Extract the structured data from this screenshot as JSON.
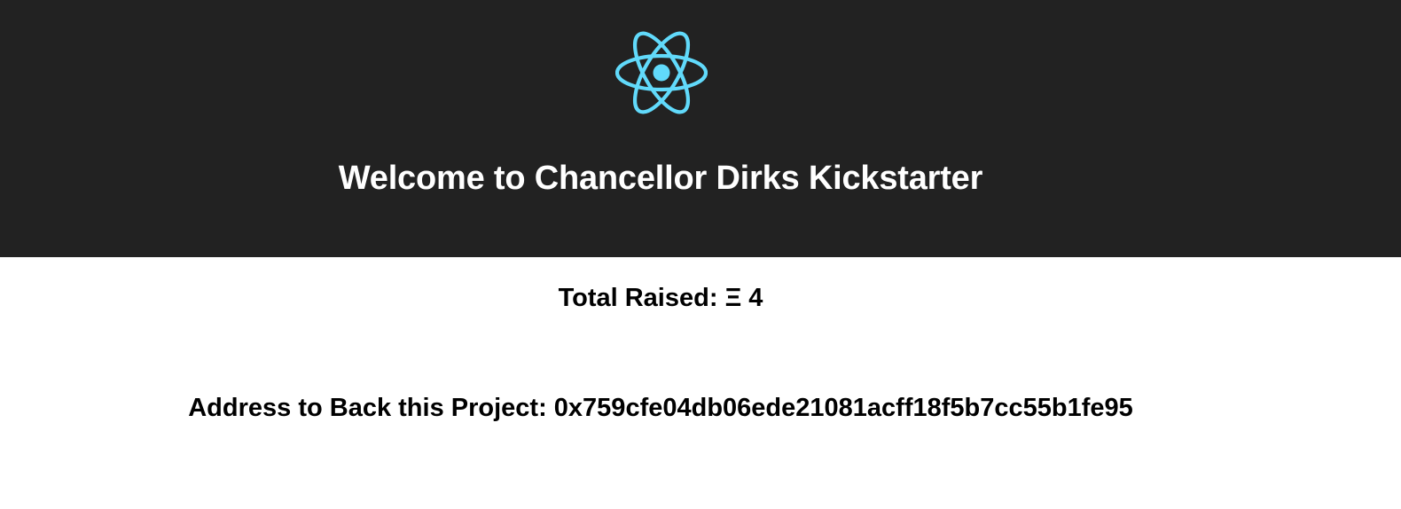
{
  "header": {
    "logo_icon": "react-atom-icon",
    "logo_color": "#61dafb",
    "background_color": "#222222",
    "title": "Welcome to Chancellor Dirks Kickstarter"
  },
  "main": {
    "total_raised_label": "Total Raised:",
    "currency_symbol": "Ξ",
    "total_raised_value": "4",
    "address_label": "Address to Back this Project:",
    "address_value": "0x759cfe04db06ede21081acff18f5b7cc55b1fe95"
  }
}
